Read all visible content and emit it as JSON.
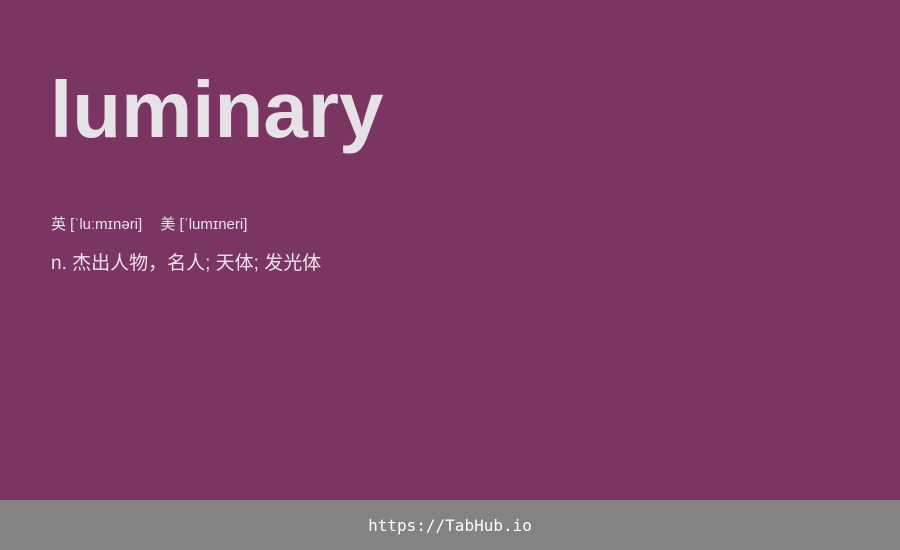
{
  "word": "luminary",
  "pronunciation": {
    "uk": "英 [ˈluːmɪnəri]",
    "us": "美 [ˈlumɪneri]"
  },
  "definition": "n. 杰出人物，名人; 天体; 发光体",
  "footer": {
    "link": "https://TabHub.io"
  },
  "colors": {
    "background": "#7b3563",
    "footer": "#838383"
  }
}
